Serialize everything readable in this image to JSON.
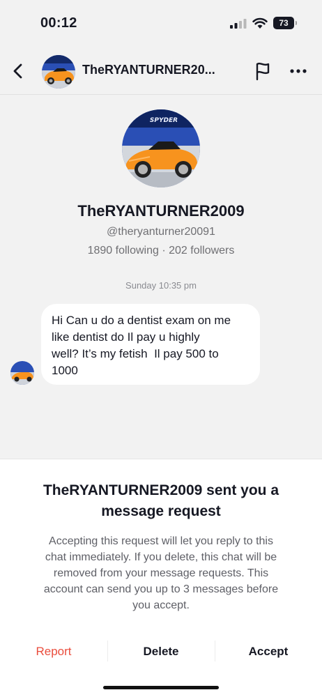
{
  "status_bar": {
    "time": "00:12",
    "battery": "73",
    "icons": [
      "signal-icon",
      "wifi-icon",
      "battery-icon"
    ]
  },
  "header": {
    "back_icon": "chevron-left-icon",
    "username": "TheRYANTURNER20...",
    "flag_icon": "flag-icon",
    "more_icon": "more-horizontal-icon"
  },
  "profile": {
    "display_name": "TheRYANTURNER2009",
    "handle": "@theryanturner20091",
    "stats": "1890 following · 202 followers",
    "avatar_text": "SPYDER"
  },
  "conversation": {
    "timestamp": "Sunday 10:35 pm",
    "messages": [
      {
        "from": "other",
        "lines": [
          "Hi Can u do a dentist exam on me",
          "like dentist do Il pay u highly",
          "well? It’s my fetish  Il pay 500 to",
          "1000"
        ]
      }
    ]
  },
  "request_sheet": {
    "title_line1": "TheRYANTURNER2009 sent you a",
    "title_line2": "message request",
    "body_lines": [
      "Accepting this request will let you reply to this",
      "chat immediately. If you delete, this chat will be",
      "removed from your message requests. This",
      "account can send you up to 3 messages before",
      "you accept."
    ],
    "actions": {
      "report": "Report",
      "delete": "Delete",
      "accept": "Accept"
    }
  },
  "colors": {
    "background": "#f2f2f2",
    "sheet": "#ffffff",
    "report_red": "#ea4d3d",
    "avatar_orange": "#f7931e",
    "avatar_sky": "#2a4fb5"
  }
}
